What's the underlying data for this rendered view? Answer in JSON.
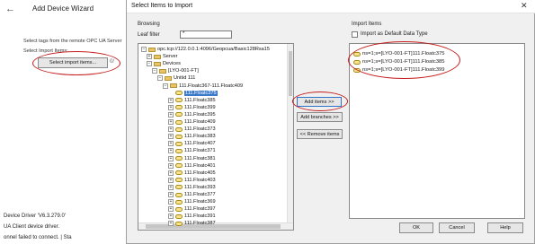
{
  "wizard": {
    "back_icon": "back-arrow-icon",
    "title": "Add Device Wizard",
    "description": "Select tags from the remote OPC UA Server",
    "sub_label": "Select Import Items:",
    "select_button": "Select import items...",
    "button_trail": "0/",
    "log": [
      "Device Driver 'V6.3.279.0'",
      "UA Client device driver.",
      "onnel failed to connect. | Sta"
    ]
  },
  "dialog": {
    "title": "Select Items to Import",
    "close_label": "✕",
    "browsing": {
      "label": "Browsing",
      "leaf_filter_label": "Leaf filter",
      "leaf_filter_value": "*",
      "tree": [
        {
          "depth": 0,
          "exp": "−",
          "icon": "folder",
          "label": "opc.tcp://122.0.0.1:4096/Geopcua/Basic128Rsa15"
        },
        {
          "depth": 1,
          "exp": "+",
          "icon": "folder",
          "label": "Server"
        },
        {
          "depth": 1,
          "exp": "−",
          "icon": "folder",
          "label": "Devices"
        },
        {
          "depth": 2,
          "exp": "−",
          "icon": "folder",
          "label": "[LYO-001-FT]"
        },
        {
          "depth": 3,
          "exp": "−",
          "icon": "folder",
          "label": "Unitid 111"
        },
        {
          "depth": 4,
          "exp": "−",
          "icon": "folder",
          "label": "111.Floatc367-111.Floatc409"
        },
        {
          "depth": 5,
          "exp": "",
          "icon": "tag",
          "label": "111.Floatc375",
          "selected": true
        },
        {
          "depth": 5,
          "exp": "+",
          "icon": "tag",
          "label": "111.Floatc385"
        },
        {
          "depth": 5,
          "exp": "+",
          "icon": "tag",
          "label": "111.Floatc399"
        },
        {
          "depth": 5,
          "exp": "+",
          "icon": "tag",
          "label": "111.Floatc395"
        },
        {
          "depth": 5,
          "exp": "+",
          "icon": "tag",
          "label": "111.Floatc409"
        },
        {
          "depth": 5,
          "exp": "+",
          "icon": "tag",
          "label": "111.Floatc373"
        },
        {
          "depth": 5,
          "exp": "+",
          "icon": "tag",
          "label": "111.Floatc383"
        },
        {
          "depth": 5,
          "exp": "+",
          "icon": "tag",
          "label": "111.Floatc407"
        },
        {
          "depth": 5,
          "exp": "+",
          "icon": "tag",
          "label": "111.Floatc371"
        },
        {
          "depth": 5,
          "exp": "+",
          "icon": "tag",
          "label": "111.Floatc381"
        },
        {
          "depth": 5,
          "exp": "+",
          "icon": "tag",
          "label": "111.Floatc401"
        },
        {
          "depth": 5,
          "exp": "+",
          "icon": "tag",
          "label": "111.Floatc405"
        },
        {
          "depth": 5,
          "exp": "+",
          "icon": "tag",
          "label": "111.Floatc403"
        },
        {
          "depth": 5,
          "exp": "+",
          "icon": "tag",
          "label": "111.Floatc393"
        },
        {
          "depth": 5,
          "exp": "+",
          "icon": "tag",
          "label": "111.Floatc377"
        },
        {
          "depth": 5,
          "exp": "+",
          "icon": "tag",
          "label": "111.Floatc369"
        },
        {
          "depth": 5,
          "exp": "+",
          "icon": "tag",
          "label": "111.Floatc397"
        },
        {
          "depth": 5,
          "exp": "+",
          "icon": "tag",
          "label": "111.Floatc391"
        },
        {
          "depth": 5,
          "exp": "+",
          "icon": "tag",
          "label": "111.Floatc387"
        }
      ]
    },
    "actions": {
      "add_items": "Add items >>",
      "add_branches": "Add branches >>",
      "remove_items": "<< Remove items"
    },
    "import_items": {
      "label": "Import Items",
      "default_type_label": "Import as Default Data Type",
      "items": [
        "ns=1;s=[LYO-001-FT]111.Floatc375",
        "ns=1;s=[LYO-001-FT]111.Floatc385",
        "ns=1;s=[LYO-001-FT]111.Floatc399"
      ]
    },
    "footer": {
      "ok": "OK",
      "cancel": "Cancel",
      "help": "Help"
    }
  },
  "annotation_color": "#c41c1c"
}
